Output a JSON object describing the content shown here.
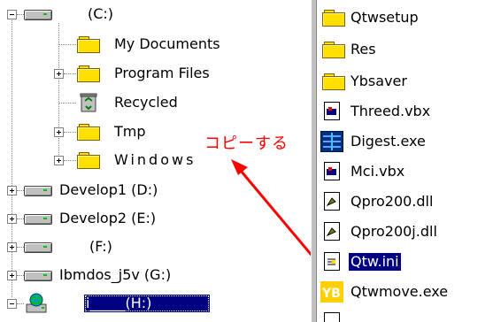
{
  "tree": {
    "root_drive_label": "(C:)",
    "folders": [
      {
        "label": "My Documents",
        "expandable": false
      },
      {
        "label": "Program Files",
        "expandable": true
      },
      {
        "label": "Recycled",
        "expandable": false
      },
      {
        "label": "Tmp",
        "expandable": true
      },
      {
        "label": "Windows",
        "expandable": true
      }
    ],
    "drives": [
      {
        "label": "Develop1 (D:)",
        "expandable": true
      },
      {
        "label": "Develop2 (E:)",
        "expandable": true
      },
      {
        "label": "(F:)",
        "expandable": true
      },
      {
        "label": "Ibmdos_j5v (G:)",
        "expandable": true
      },
      {
        "label": "i_____(H:)",
        "expandable": true,
        "selected": true
      }
    ]
  },
  "files": [
    {
      "name": "Qtwsetup",
      "icon": "folder-icon"
    },
    {
      "name": "Res",
      "icon": "folder-icon"
    },
    {
      "name": "Ybsaver",
      "icon": "folder-icon"
    },
    {
      "name": "Threed.vbx",
      "icon": "vbx-file-icon"
    },
    {
      "name": "Digest.exe",
      "icon": "exe-file-icon"
    },
    {
      "name": "Mci.vbx",
      "icon": "vbx-file-icon"
    },
    {
      "name": "Qpro200.dll",
      "icon": "dll-file-icon"
    },
    {
      "name": "Qpro200j.dll",
      "icon": "dll-file-icon"
    },
    {
      "name": "Qtw.ini",
      "icon": "ini-file-icon",
      "selected": true
    },
    {
      "name": "Qtwmove.exe",
      "icon": "yb-exe-icon"
    }
  ],
  "annotation": {
    "text": "コピーする",
    "color": "#ff0000"
  },
  "colors": {
    "selection": "#000080",
    "folder": "#ffe000"
  }
}
